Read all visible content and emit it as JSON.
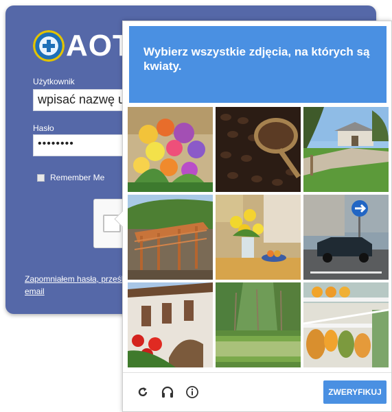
{
  "login": {
    "brand": "AOTM",
    "username_label": "Użytkownik",
    "username_value": "wpisać nazwę uż",
    "password_label": "Hasło",
    "password_value": "••••••••",
    "remember_label": "Remember Me",
    "forgot_text": "Zapomniałem hasła, prześlij email"
  },
  "captcha": {
    "prompt_prefix": "Wybierz wszystkie zdjęcia, na których są",
    "prompt_keyword": "kwiaty",
    "prompt_suffix": ".",
    "tiles": [
      {
        "subject": "flower bouquet"
      },
      {
        "subject": "coffee beans"
      },
      {
        "subject": "house with lawn"
      },
      {
        "subject": "wooden pergola"
      },
      {
        "subject": "flowers on table"
      },
      {
        "subject": "street with car"
      },
      {
        "subject": "building with red flowers"
      },
      {
        "subject": "pond with trees"
      },
      {
        "subject": "fruit stand"
      }
    ],
    "verify_label": "ZWERYFIKUJ",
    "icons": [
      "reload-icon",
      "audio-icon",
      "info-icon"
    ]
  },
  "colors": {
    "panel": "#5568a8",
    "accent": "#4a90e2"
  }
}
